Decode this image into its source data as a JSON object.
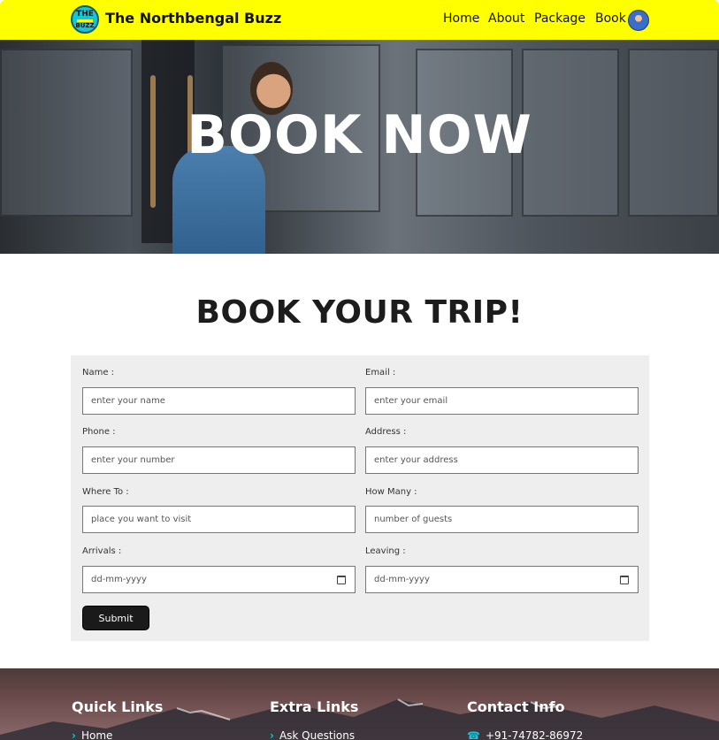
{
  "header": {
    "logo_top": "THE",
    "logo_bottom": "BUZZ",
    "brand": "The Northbengal Buzz",
    "nav": [
      "Home",
      "About",
      "Package",
      "Book"
    ],
    "accent_color": "#ffff00"
  },
  "hero": {
    "title": "BOOK NOW"
  },
  "section": {
    "title": "BOOK YOUR TRIP!"
  },
  "form": {
    "fields": [
      {
        "label": "Name :",
        "placeholder": "enter your name"
      },
      {
        "label": "Email :",
        "placeholder": "enter your email"
      },
      {
        "label": "Phone :",
        "placeholder": "enter your number"
      },
      {
        "label": "Address :",
        "placeholder": "enter your address"
      },
      {
        "label": "Where To :",
        "placeholder": "place you want to visit"
      },
      {
        "label": "How Many :",
        "placeholder": "number of guests"
      },
      {
        "label": "Arrivals :",
        "placeholder": "dd-mm-yyyy"
      },
      {
        "label": "Leaving :",
        "placeholder": "dd-mm-yyyy"
      }
    ],
    "submit_label": "Submit"
  },
  "footer": {
    "quick_links_title": "Quick Links",
    "extra_links_title": "Extra Links",
    "contact_title": "Contact Info",
    "quick_link_1": "Home",
    "extra_link_1": "Ask Questions",
    "contact_phone": "+91-74782-86972",
    "icon_color": "#12c7d8"
  }
}
